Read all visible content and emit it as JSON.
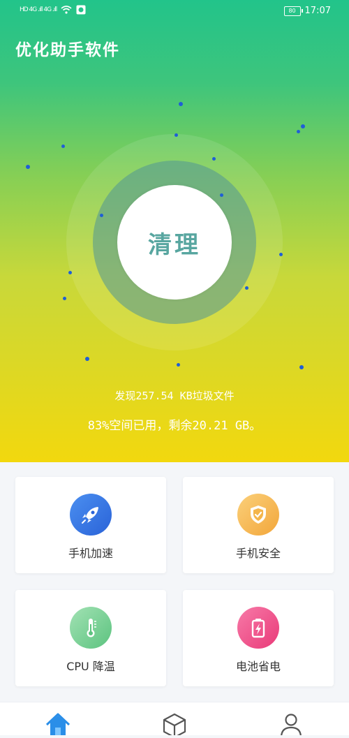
{
  "status_bar": {
    "left_indicators": "HD  4G .ıll  4G .ıll",
    "battery_level": "80",
    "time": "17:07"
  },
  "app": {
    "title": "优化助手软件"
  },
  "hero": {
    "clean_button_label": "清理",
    "found_text": "发现257.54 KB垃圾文件",
    "storage_text": "83%空间已用，剩余20.21 GB。"
  },
  "cards": [
    {
      "label": "手机加速",
      "icon": "rocket-icon",
      "color": "#3a7be8"
    },
    {
      "label": "手机安全",
      "icon": "shield-icon",
      "color": "#f4b54a"
    },
    {
      "label": "CPU 降温",
      "icon": "thermometer-icon",
      "color": "#6ccf8e"
    },
    {
      "label": "电池省电",
      "icon": "battery-charge-icon",
      "color": "#f0508a"
    }
  ],
  "tabs": [
    {
      "icon": "home-icon",
      "active": true
    },
    {
      "icon": "box-icon",
      "active": false
    },
    {
      "icon": "user-icon",
      "active": false
    }
  ]
}
